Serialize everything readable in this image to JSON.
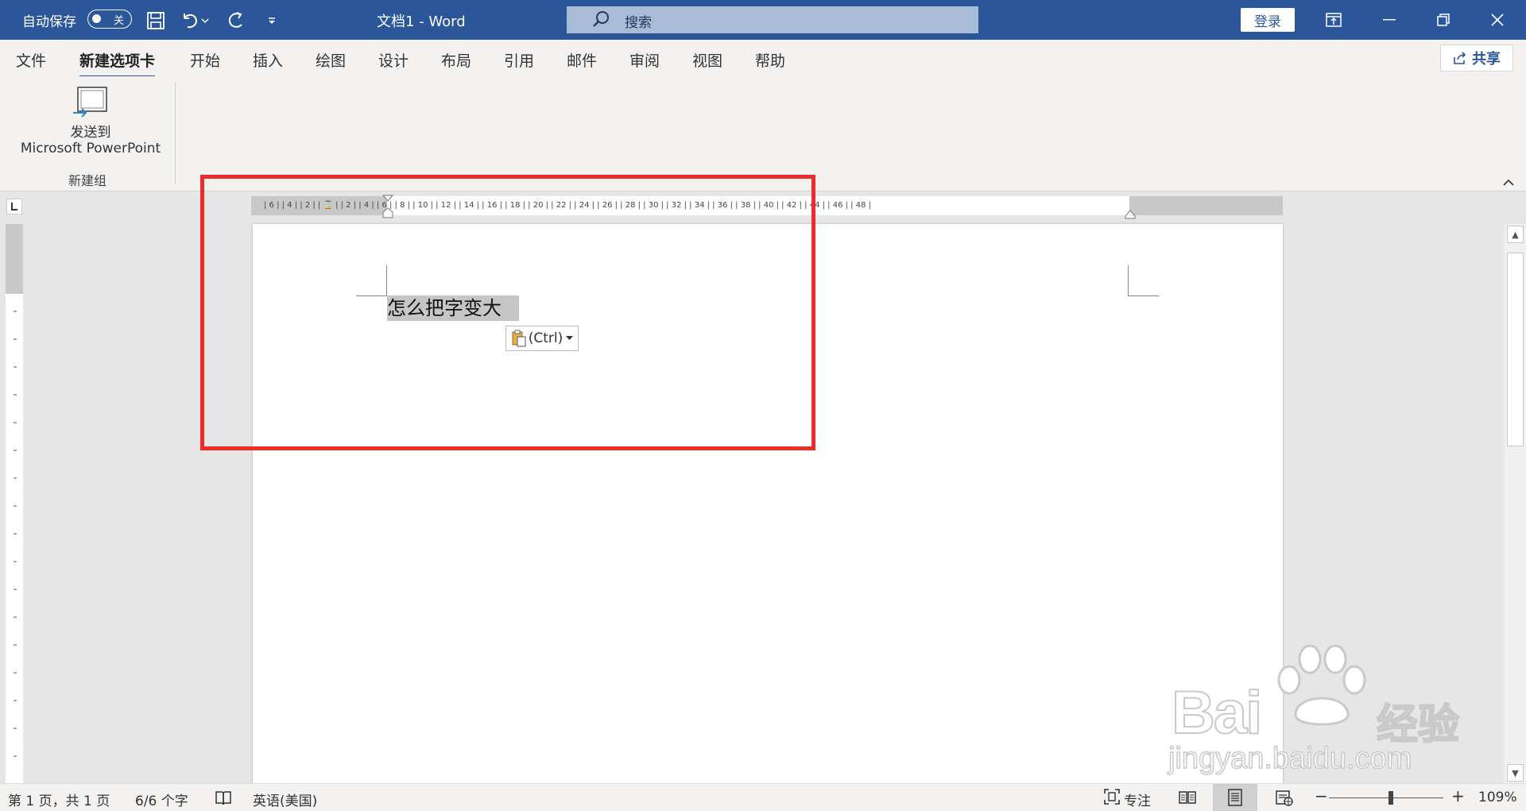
{
  "titlebar": {
    "autosave_label": "自动保存",
    "autosave_state": "关",
    "doc_title": "文档1  -  Word",
    "search_placeholder": "搜索",
    "login_label": "登录"
  },
  "tabs": [
    {
      "label": "文件"
    },
    {
      "label": "新建选项卡",
      "active": true
    },
    {
      "label": "开始"
    },
    {
      "label": "插入"
    },
    {
      "label": "绘图"
    },
    {
      "label": "设计"
    },
    {
      "label": "布局"
    },
    {
      "label": "引用"
    },
    {
      "label": "邮件"
    },
    {
      "label": "审阅"
    },
    {
      "label": "视图"
    },
    {
      "label": "帮助"
    }
  ],
  "share_label": "共享",
  "ribbon": {
    "send_line1": "发送到",
    "send_line2": "Microsoft PowerPoint",
    "group_label": "新建组"
  },
  "ruler": {
    "ticks": "| 6 |    | 4 |    | 2 |    |  ⌛  |    | 2 |    | 4 |    | 6 |    | 8 |    | 10 |    | 12 |    | 14 |    | 16 |    | 18 |    | 20 |    | 22 |    | 24 |    | 26 |    | 28 |    | 30 |    | 32 |    | 34 |    | 36 |    | 38 |    | 40 |    | 42 |    | 44 |    | 46 |    | 48 |"
  },
  "document": {
    "selected_text": "怎么把字变大",
    "paste_options": "(Ctrl)"
  },
  "status": {
    "page": "第 1 页，共 1 页",
    "words": "6/6 个字",
    "language": "英语(美国)",
    "focus": "专注",
    "zoom": "109%"
  },
  "watermark": {
    "brand": "Bai",
    "brand2": "经验",
    "url": "jingyan.baidu.com"
  },
  "colors": {
    "accent": "#2b579a",
    "highlight": "#ee2b2b"
  }
}
